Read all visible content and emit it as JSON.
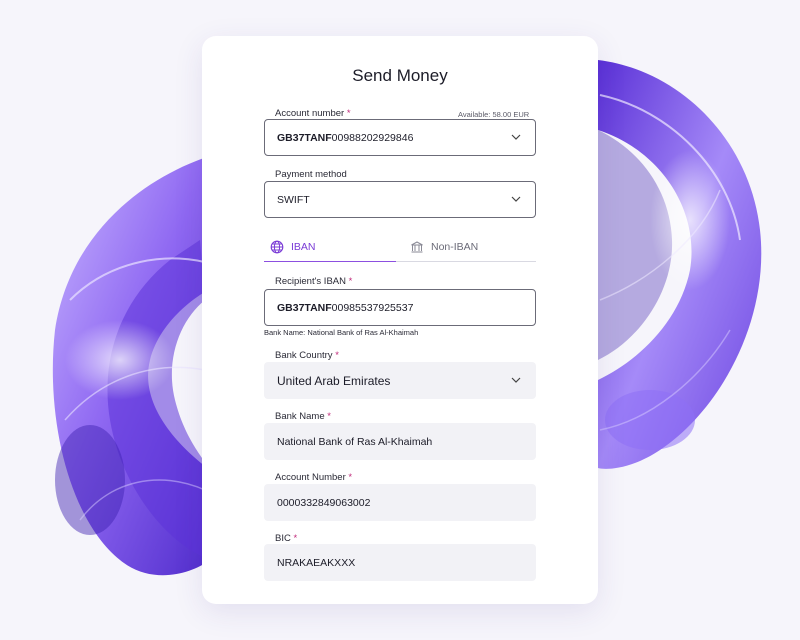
{
  "form": {
    "title": "Send Money",
    "account": {
      "label": "Account number",
      "required_mark": "*",
      "available": "Available: 58.00 EUR",
      "value_bold": "GB37TANF",
      "value_rest": "00988202929846"
    },
    "payment_method": {
      "label": "Payment method",
      "value": "SWIFT"
    },
    "tabs": {
      "iban": "IBAN",
      "non_iban": "Non-IBAN"
    },
    "recipient_iban": {
      "label": "Recipient's IBAN",
      "required_mark": "*",
      "value_bold": "GB37TANF",
      "value_rest": "00985537925537",
      "hint": "Bank Name: National Bank of Ras Al-Khaimah"
    },
    "bank_country": {
      "label": "Bank Country",
      "required_mark": "*",
      "value": "United Arab Emirates"
    },
    "bank_name": {
      "label": "Bank Name",
      "required_mark": "*",
      "value": "National Bank of Ras Al-Khaimah"
    },
    "account_number": {
      "label": "Account Number",
      "required_mark": "*",
      "value": "0000332849063002"
    },
    "bic": {
      "label": "BIC",
      "required_mark": "*",
      "value": "NRAKAEAKXXX"
    }
  },
  "icons": {
    "chevron": "chevron-down-icon",
    "globe": "globe-icon",
    "bank": "bank-icon"
  },
  "colors": {
    "accent": "#8c4fe0",
    "required": "#c02a7a",
    "background": "#f6f5fb"
  }
}
